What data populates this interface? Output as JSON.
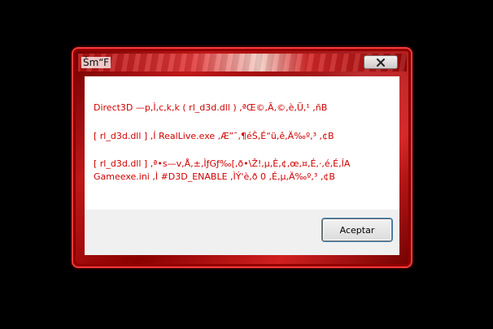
{
  "window": {
    "title": "Šm“F"
  },
  "message": {
    "lines": [
      "Direct3D —p,Ì,c,k,k ( rl_d3d.dll ) ,ªŒ©,Ã,©,è,Ü,¹ ,ñB",
      "[ rl_d3d.dll ] ,Í RealLive.exe ,Æ”¯,¶éŠ,É“ü,ê,Ä‰º,³ ,¢B",
      "[ rl_d3d.dll ] ,ª•s—v,Å,±,ÌƒGƒ‰[,ð•\\Ž!,µ,È,¢,œ,¤,É,·,é,É,ÍA",
      "Gameexe.ini ,Ì #D3D_ENABLE ,ÌÝ'è,ð 0 ,É,µ,Ä‰º,³ ,¢B"
    ]
  },
  "buttons": {
    "accept_label": "Aceptar"
  },
  "colors": {
    "frame_red": "#c01818",
    "message_text": "#d00000",
    "content_bg": "#ffffff",
    "footer_bg": "#f0f0f0",
    "page_bg": "#000000"
  },
  "icons": {
    "close": "close-icon"
  }
}
